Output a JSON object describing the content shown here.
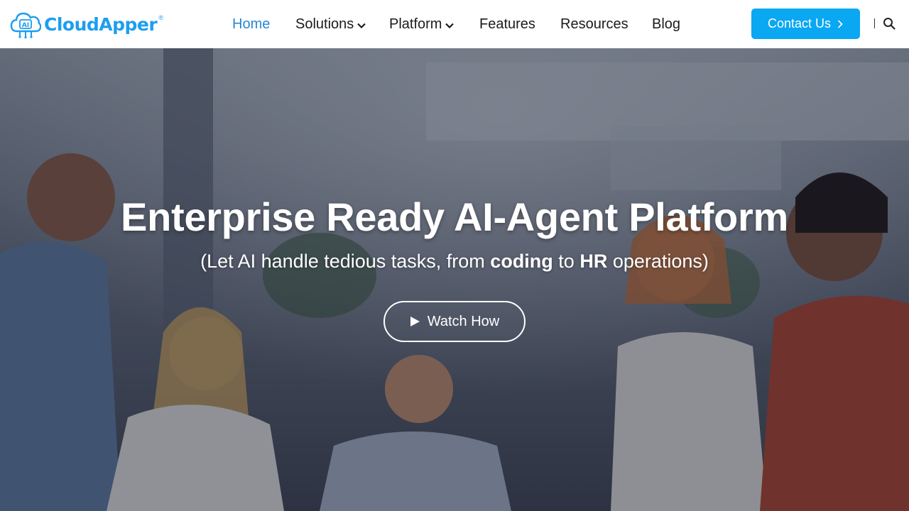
{
  "brand": {
    "name": "CloudApper",
    "reg": "®",
    "badge": "AI"
  },
  "nav": {
    "items": [
      {
        "label": "Home",
        "active": true,
        "dropdown": false
      },
      {
        "label": "Solutions",
        "active": false,
        "dropdown": true
      },
      {
        "label": "Platform",
        "active": false,
        "dropdown": true
      },
      {
        "label": "Features",
        "active": false,
        "dropdown": false
      },
      {
        "label": "Resources",
        "active": false,
        "dropdown": false
      },
      {
        "label": "Blog",
        "active": false,
        "dropdown": false
      }
    ],
    "contact_label": "Contact Us",
    "contact_icon": "chevron-right-icon",
    "search_icon": "search-icon"
  },
  "hero": {
    "title": "Enterprise Ready AI-Agent Platform",
    "subtitle_parts": [
      "(Let AI handle tedious tasks, from ",
      "coding",
      " to ",
      "HR",
      " operations)"
    ],
    "cta_label": "Watch How",
    "cta_icon": "play-icon"
  },
  "colors": {
    "brand_blue": "#1c9ef0",
    "nav_active": "#2a86d2",
    "cta_blue": "#0aa7f2",
    "text_dark": "#1b1b1b"
  }
}
